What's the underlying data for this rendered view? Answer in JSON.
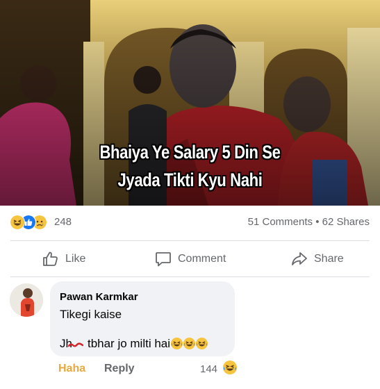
{
  "post": {
    "caption_line1": "Bhaiya Ye Salary 5 Din Se",
    "caption_line2": "Jyada Tikti Kyu Nahi"
  },
  "stats": {
    "reaction_icons": [
      "haha-icon",
      "like-icon",
      "sad-icon"
    ],
    "reaction_count": "248",
    "comments_shares": "51 Comments • 62 Shares"
  },
  "actions": {
    "like": "Like",
    "comment": "Comment",
    "share": "Share"
  },
  "comment": {
    "author": "Pawan Karmkar",
    "text_line1": "Tikegi kaise",
    "text_line2_prefix": "Jh",
    "text_line2_rest": "tbhar jo milti hai",
    "haha_label": "Haha",
    "reply_label": "Reply",
    "reaction_count": "144"
  },
  "colors": {
    "haha": "#e7a93e",
    "meta_gray": "#65676b",
    "bubble": "#f0f2f5",
    "like_blue": "#1877f2"
  }
}
